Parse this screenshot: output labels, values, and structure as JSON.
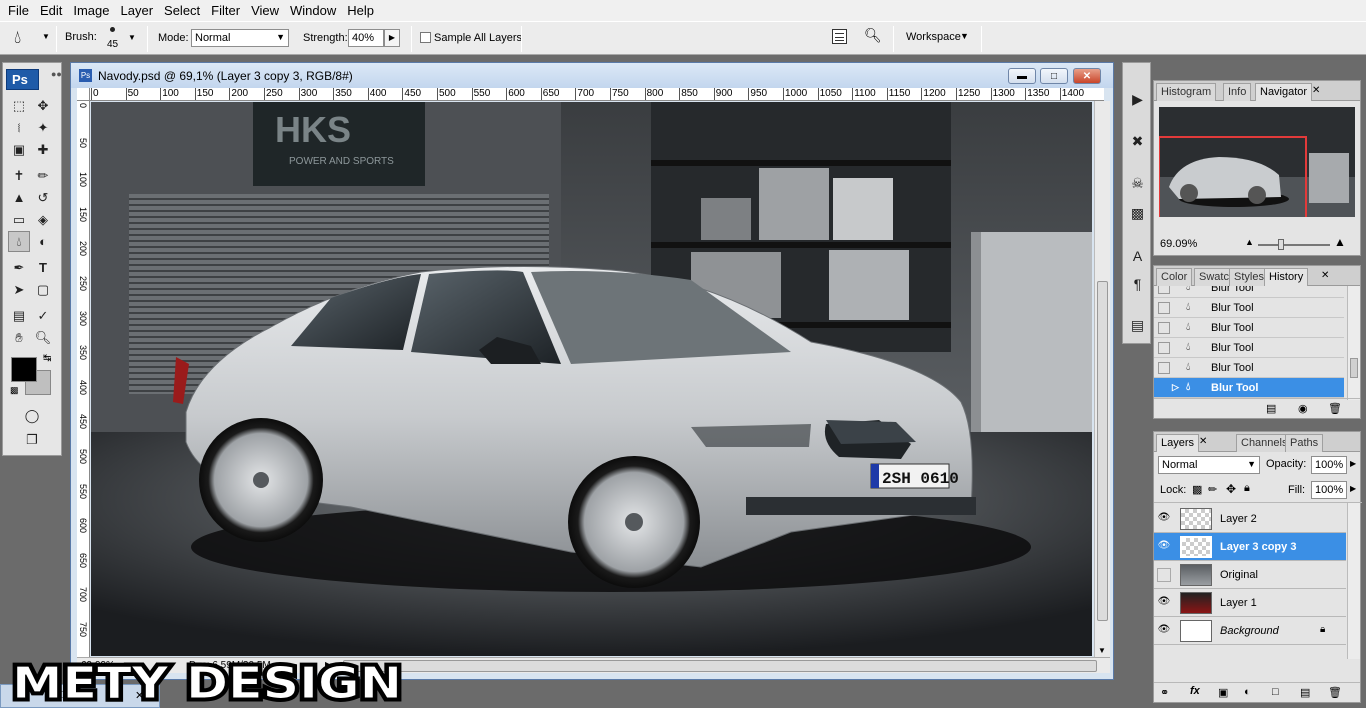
{
  "menu": [
    "File",
    "Edit",
    "Image",
    "Layer",
    "Select",
    "Filter",
    "View",
    "Window",
    "Help"
  ],
  "options": {
    "brush_label": "Brush:",
    "brush_size": "45",
    "mode_label": "Mode:",
    "mode_value": "Normal",
    "strength_label": "Strength:",
    "strength_value": "40%",
    "sample_all_label": "Sample All Layers",
    "workspace_label": "Workspace"
  },
  "tools": {
    "logo": "Ps"
  },
  "document": {
    "title": "Navody.psd @ 69,1% (Layer 3 copy 3, RGB/8#)",
    "ruler_marks": [
      "0",
      "50",
      "100",
      "150",
      "200",
      "250",
      "300",
      "350",
      "400",
      "450",
      "500",
      "550",
      "600",
      "650",
      "700",
      "750",
      "800",
      "850",
      "900",
      "950",
      "1000",
      "1050",
      "1100",
      "1150",
      "1200",
      "1250",
      "1300",
      "1350",
      "1400"
    ],
    "vruler_marks": [
      "0",
      "50",
      "100",
      "150",
      "200",
      "250",
      "300",
      "350",
      "400",
      "450",
      "500",
      "550",
      "600",
      "650",
      "700",
      "750"
    ],
    "status_zoom": "69,09%",
    "status_doc": "Doc: 6,59M/30,5M",
    "photo": {
      "banner_text": "HKS",
      "banner_sub": "POWER AND SPORTS",
      "plate": "2SH 0610"
    }
  },
  "navigator": {
    "tabs": [
      "Histogram",
      "Info",
      "Navigator"
    ],
    "zoom": "69.09%"
  },
  "history": {
    "tabs": [
      "Color",
      "Swatc",
      "Styles",
      "History"
    ],
    "items": [
      "Blur Tool",
      "Blur Tool",
      "Blur Tool",
      "Blur Tool",
      "Blur Tool",
      "Blur Tool"
    ]
  },
  "layers": {
    "tabs": [
      "Layers",
      "Channels",
      "Paths"
    ],
    "blend_mode": "Normal",
    "opacity_label": "Opacity:",
    "opacity": "100%",
    "lock_label": "Lock:",
    "fill_label": "Fill:",
    "fill": "100%",
    "items": [
      {
        "name": "Layer 2",
        "visible": true
      },
      {
        "name": "Layer 3 copy 3",
        "visible": true
      },
      {
        "name": "Original",
        "visible": false
      },
      {
        "name": "Layer 1",
        "visible": true
      },
      {
        "name": "Background",
        "visible": true
      }
    ]
  },
  "watermark": "METY DESIGN",
  "colors": {
    "selection": "#3b8fe5",
    "foreground": "#000000",
    "background": "#bfbfbf"
  }
}
